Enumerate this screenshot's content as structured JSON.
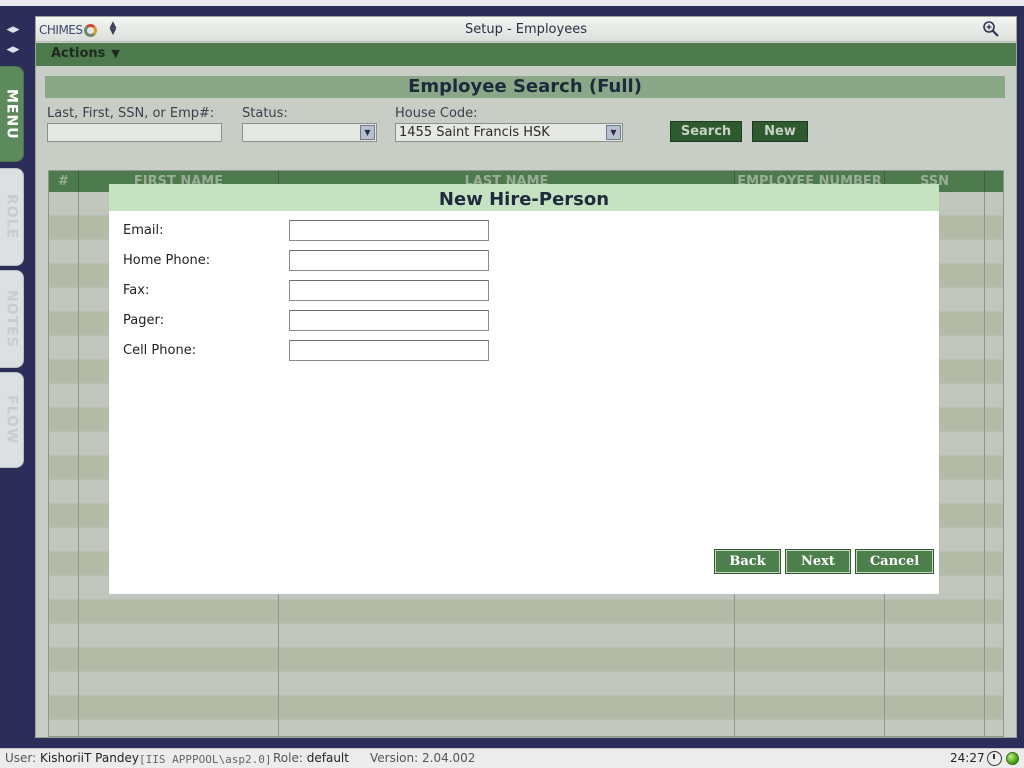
{
  "window": {
    "logo_text": "CHIMES",
    "title": "Setup - Employees"
  },
  "sidebar": {
    "tabs": [
      {
        "label": "MENU",
        "active": true
      },
      {
        "label": "ROLE",
        "active": false
      },
      {
        "label": "NOTES",
        "active": false
      },
      {
        "label": "FLOW",
        "active": false
      }
    ]
  },
  "action_bar": {
    "actions_label": "Actions",
    "caret": "▼"
  },
  "search": {
    "heading": "Employee Search (Full)",
    "name_label": "Last, First, SSN, or Emp#:",
    "name_value": "",
    "status_label": "Status:",
    "status_value": "",
    "house_code_label": "House Code:",
    "house_code_value": "1455 Saint Francis HSK",
    "search_button": "Search",
    "new_button": "New"
  },
  "table": {
    "columns": [
      "#",
      "FIRST NAME",
      "LAST NAME",
      "EMPLOYEE NUMBER",
      "SSN"
    ],
    "rows": []
  },
  "modal": {
    "title": "New Hire-Person",
    "fields": [
      {
        "label": "Email:",
        "value": ""
      },
      {
        "label": "Home Phone:",
        "value": ""
      },
      {
        "label": "Fax:",
        "value": ""
      },
      {
        "label": "Pager:",
        "value": ""
      },
      {
        "label": "Cell Phone:",
        "value": ""
      }
    ],
    "buttons": {
      "back": "Back",
      "next": "Next",
      "cancel": "Cancel"
    }
  },
  "status_bar": {
    "user_label": "User:",
    "user_value": "KishoriiT Pandey",
    "pool": "[IIS APPPOOL\\asp2.0]",
    "role_label": "Role:",
    "role_value": "default",
    "version_label": "Version:",
    "version_value": "2.04.002",
    "time": "24:27"
  },
  "colors": {
    "accent_green": "#4d7a4d",
    "modal_header": "#c5e3c0",
    "background": "#2d2d5a",
    "status_ok": "#4aa516"
  }
}
